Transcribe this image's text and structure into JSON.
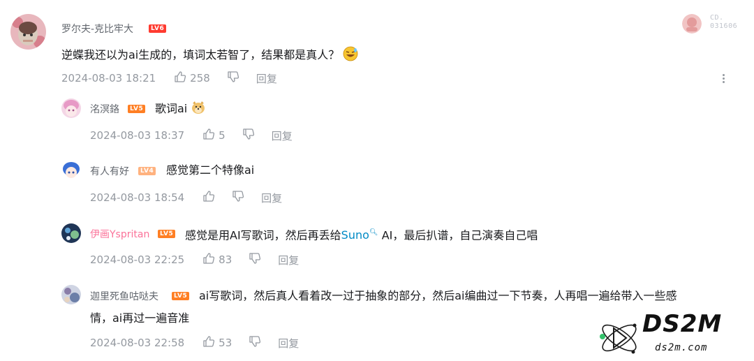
{
  "side_badge": {
    "line1": "CD.",
    "line2": "031606"
  },
  "main_comment": {
    "username": "罗尔夫-克比牢大",
    "level": "LV6",
    "content_text": "逆蝶我还以为ai生成的，填词太若智了，结果都是真人？",
    "content_emoji": "sweat-laugh-emoji",
    "date": "2024-08-03 18:21",
    "likes": "258",
    "reply_label": "回复"
  },
  "replies": [
    {
      "username": "洺溟鉻",
      "level": "LV5",
      "content": "歌词ai",
      "emoji": "doge-emoji",
      "date": "2024-08-03 18:37",
      "likes": "5",
      "reply_label": "回复"
    },
    {
      "username": "有人有好",
      "level": "LV4",
      "content": "感觉第二个特像ai",
      "date": "2024-08-03 18:54",
      "likes": "",
      "reply_label": "回复"
    },
    {
      "username": "伊画Yspritan",
      "level": "LV5",
      "content_before": "感觉是用AI写歌词，然后再丢给",
      "link": "Suno",
      "content_after": " AI，最后扒谱，自己演奏自己唱",
      "date": "2024-08-03 22:25",
      "likes": "83",
      "reply_label": "回复"
    },
    {
      "username": "迦里死鱼咕哒夫",
      "level": "LV5",
      "content_line1": "ai写歌词，然后真人看着改一过于抽象的部分，然后ai编曲过一下节奏，人再唱一遍给带入一些感",
      "content_line2": "情，ai再过一遍音准",
      "date": "2024-08-03 22:58",
      "likes": "53",
      "reply_label": "回复"
    }
  ],
  "watermark": {
    "big": "DS2M",
    "small": "ds2m.com"
  },
  "colors": {
    "username_pink": "#fb7299",
    "link_blue": "#008ac5",
    "meta_gray": "#9499a0",
    "level_badge": "#ff6699"
  }
}
